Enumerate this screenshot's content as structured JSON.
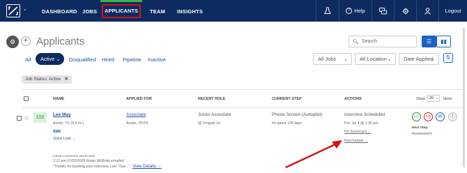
{
  "nav": {
    "items": [
      "DASHBOARD",
      "JOBS",
      "APPLICANTS",
      "TEAM",
      "INSIGHTS"
    ],
    "help": "Help",
    "logout": "Logout"
  },
  "page": {
    "title": "Applicants",
    "search_placeholder": "Search"
  },
  "filters": {
    "tabs": [
      "All",
      "Active",
      "Disqualified",
      "Hired",
      "Pipeline",
      "Inactive"
    ],
    "dropdowns": [
      "All Jobs",
      "All Location",
      "Date Applied"
    ]
  },
  "chip": "Job Status: Active",
  "table": {
    "headers": [
      "NAME",
      "APPLIED FOR",
      "RECENT ROLE",
      "CURRENT STEP",
      "ACTIONS"
    ],
    "show_label": "Show",
    "show_value": "20",
    "items_label": "Items"
  },
  "row": {
    "score": "100",
    "name": "Lee May",
    "location": "Austin, TX (5.6 mi.)",
    "sms": "SMS",
    "quick_look": "Quick Look →",
    "applied_for": "Associate",
    "applied_location": "Austin, 78701",
    "recent_role": "Junior Associate",
    "recent_company": "@ Umgadi Inc",
    "current_step": "Phone Screen (Autopilot)",
    "step_duration": "for about 128 days",
    "action_status": "Interview Scheduled",
    "action_time": "For: Jul 4 @ 1:30 pm",
    "fill_scorecard": "Fill Scorecard →",
    "reschedule": "Reschedule →",
    "next_step_label": "Next Step:",
    "next_step_value": "Assessment",
    "comments_label": "Latest Comments and Emails",
    "comment_meta": "5:12 pm 07/02/2025 Nolan McBride emailed:",
    "comment_text": "\"Thanks for booking your interview, Lee! Your...\"",
    "view_details": "View Details →"
  },
  "colors": {
    "nav_bg": "#0d2b5e",
    "accent": "#1c62c9",
    "active_highlight": "#d0141a",
    "score_green": "#2b8a3e",
    "arrow": "#d0141a"
  }
}
